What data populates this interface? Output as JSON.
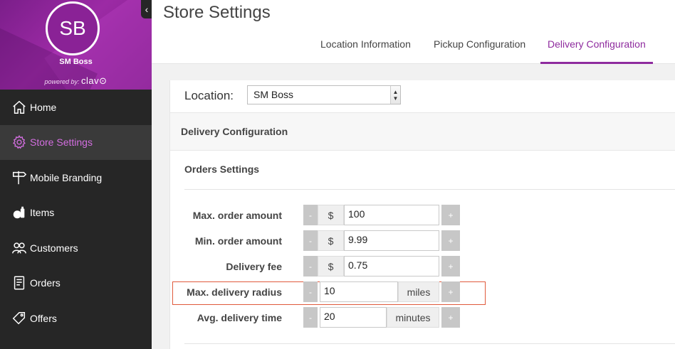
{
  "sidebar": {
    "avatar_initials": "SB",
    "brand_name": "SM Boss",
    "powered_by": "powered by:",
    "powered_brand": "clav⊙",
    "collapse_icon": "‹",
    "items": [
      {
        "label": "Home",
        "icon": "home-icon"
      },
      {
        "label": "Store Settings",
        "icon": "gear-icon"
      },
      {
        "label": "Mobile Branding",
        "icon": "signpost-icon"
      },
      {
        "label": "Items",
        "icon": "items-icon"
      },
      {
        "label": "Customers",
        "icon": "customers-icon"
      },
      {
        "label": "Orders",
        "icon": "orders-icon"
      },
      {
        "label": "Offers",
        "icon": "tag-icon"
      }
    ],
    "active_index": 1
  },
  "header": {
    "title": "Store Settings",
    "tabs": [
      {
        "label": "Location Information"
      },
      {
        "label": "Pickup Configuration"
      },
      {
        "label": "Delivery Configuration"
      }
    ],
    "active_tab": 2
  },
  "location": {
    "label": "Location:",
    "selected": "SM Boss"
  },
  "section": {
    "title": "Delivery Configuration",
    "subtitle": "Orders Settings"
  },
  "fields": [
    {
      "label": "Max. order amount",
      "prefix": "$",
      "value": "100",
      "minus": "-",
      "plus": "+"
    },
    {
      "label": "Min. order amount",
      "prefix": "$",
      "value": "9.99",
      "minus": "-",
      "plus": "+"
    },
    {
      "label": "Delivery fee",
      "prefix": "$",
      "value": "0.75",
      "minus": "-",
      "plus": "+"
    },
    {
      "label": "Max. delivery radius",
      "suffix": "miles",
      "value": "10",
      "minus": "-",
      "plus": "+"
    },
    {
      "label": "Avg. delivery time",
      "suffix": "minutes",
      "value": "20",
      "minus": "-",
      "plus": "+"
    }
  ],
  "colors": {
    "accent": "#8e2b9e",
    "sidebar_bg": "#262626",
    "highlight_border": "#e05a3c"
  }
}
